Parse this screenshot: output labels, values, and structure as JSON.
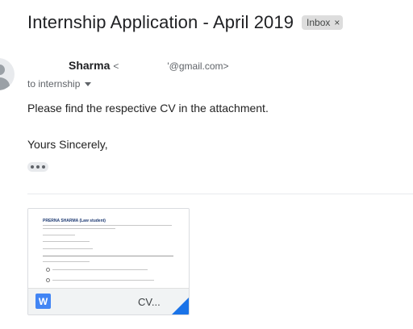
{
  "email": {
    "subject": "Internship Application - April 2019",
    "label": "Inbox",
    "label_close": "×",
    "sender_name": "Sharma",
    "sender_open": "<",
    "sender_email": "'@gmail.com>",
    "recipient": "to internship",
    "body_line1": "Please find the respective CV in the attachment.",
    "body_line2": "Yours Sincerely,"
  },
  "attachment": {
    "file_name": "CV...",
    "file_type_icon": "W",
    "preview_title": "PRERNA SHARMA (Law student)",
    "icons": [
      "word-doc-icon",
      "avatar-icon",
      "more-icon",
      "chevron-down-icon"
    ]
  },
  "colors": {
    "word_blue": "#4285f4",
    "fold_blue": "#1a73e8",
    "chip_bg": "#dddddd"
  }
}
